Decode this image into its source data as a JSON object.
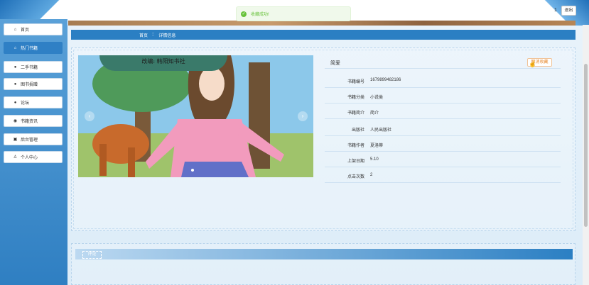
{
  "header": {
    "user_count": "1",
    "logout_label": "退出"
  },
  "toast": {
    "message": "收藏成功!"
  },
  "sidebar": {
    "items": [
      {
        "label": "首页",
        "icon": "home-icon",
        "active": false
      },
      {
        "label": "热门书籍",
        "icon": "fire-icon",
        "active": true
      },
      {
        "label": "二手书籍",
        "icon": "book-icon",
        "active": false
      },
      {
        "label": "图书捐赠",
        "icon": "gift-icon",
        "active": false
      },
      {
        "label": "论坛",
        "icon": "forum-icon",
        "active": false
      },
      {
        "label": "书籍资讯",
        "icon": "news-icon",
        "active": false
      },
      {
        "label": "后台管理",
        "icon": "admin-icon",
        "active": false
      },
      {
        "label": "个人中心",
        "icon": "user-icon",
        "active": false
      }
    ]
  },
  "breadcrumb": {
    "home": "首页",
    "separator": "::",
    "current": "详情信息"
  },
  "carousel": {
    "caption": "改编: 韩阳知书社",
    "prev": "‹",
    "next": "›"
  },
  "detail": {
    "title": "简爱",
    "favorite_label": "取消收藏",
    "rows": [
      {
        "label": "书籍编号",
        "value": "1679899482186"
      },
      {
        "label": "书籍分类",
        "value": "小说类"
      },
      {
        "label": "书籍简介",
        "value": "简介"
      },
      {
        "label": "出版社",
        "value": "人民出版社"
      },
      {
        "label": "书籍作者",
        "value": "夏洛蒂"
      },
      {
        "label": "上架日期",
        "value": "5.10"
      },
      {
        "label": "点击次数",
        "value": "2"
      }
    ]
  },
  "comment": {
    "tab_label": "评论"
  },
  "colors": {
    "primary": "#2b7fc3",
    "success": "#67c23a",
    "favorite": "#e6862a"
  }
}
